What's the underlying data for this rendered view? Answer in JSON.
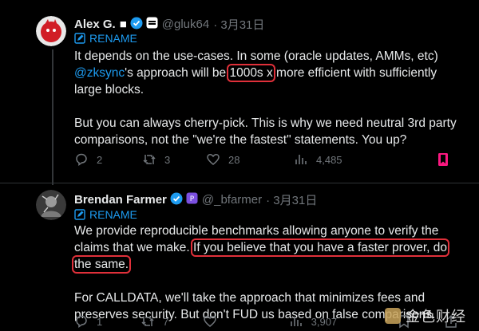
{
  "colors": {
    "accent": "#1d9bf0",
    "highlight_box": "#e0303a",
    "bookmark": "#f91880"
  },
  "tweets": [
    {
      "name": "Alex G.",
      "flag": "■",
      "handle": "@gluk64",
      "date": "· 3月31日",
      "rename": "RENAME",
      "p1_before_mention": "It depends on the use-cases. In some (oracle updates, AMMs, etc)",
      "mention": "@zksync",
      "p1_mid": "'s approach will be ",
      "p1_highlight": "1000s x",
      "p1_after": " more efficient with sufficiently large blocks.",
      "p2": "But you can always cherry-pick. This is why we need neutral 3rd party comparisons, not the \"we're the fastest\" statements. You up?",
      "stats": {
        "replies": "2",
        "retweets": "3",
        "likes": "",
        "views": "4,485"
      }
    },
    {
      "name": "Brendan Farmer",
      "handle": "@_bfarmer",
      "date": "· 3月31日",
      "rename": "RENAME",
      "p1_before": "We provide reproducible benchmarks allowing anyone to  verify the claims that we make. ",
      "p1_highlight": "If you believe that you have a faster prover, do the same.",
      "p2": "For CALLDATA, we'll take the approach that minimizes fees and preserves security. But don't FUD us based on false comparisons.",
      "stats": {
        "replies": "1",
        "retweets": "7",
        "likes": "",
        "views": "3,907"
      }
    }
  ],
  "t1_likes": "28",
  "watermark": "金色财经"
}
